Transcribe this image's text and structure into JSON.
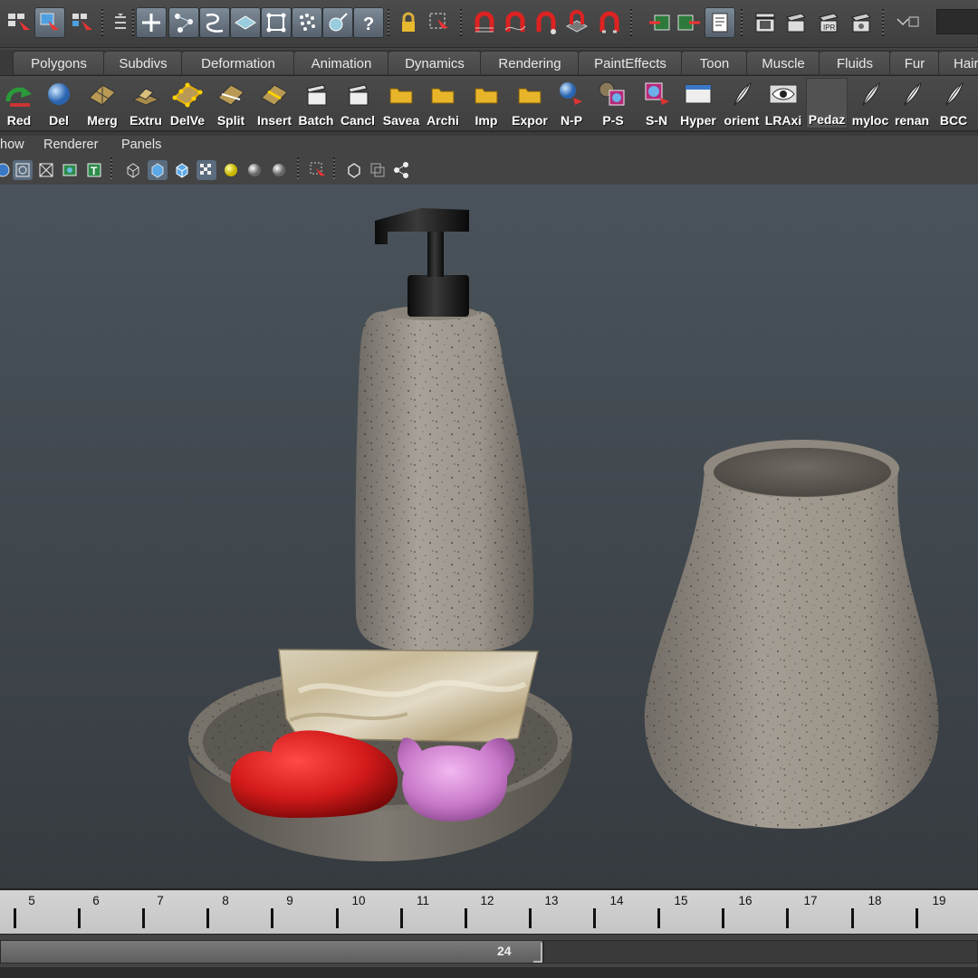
{
  "shelf_tabs": [
    "Polygons",
    "Subdivs",
    "Deformation",
    "Animation",
    "Dynamics",
    "Rendering",
    "PaintEffects",
    "Toon",
    "Muscle",
    "Fluids",
    "Fur",
    "Hair"
  ],
  "shelf_buttons": [
    "Red",
    "Del",
    "Merg",
    "Extru",
    "DelVe",
    "Split",
    "Insert",
    "Batch",
    "Cancl",
    "Savea",
    "Archi",
    "Imp",
    "Expor",
    "N-P",
    "P-S",
    "S-N",
    "Hyper",
    "orient",
    "LRAxi",
    "Pedaz",
    "myloc",
    "renan",
    "BCC"
  ],
  "panel_menu": {
    "show": "how",
    "renderer": "Renderer",
    "panels": "Panels"
  },
  "panel_toolbar": {
    "text_icon": "T"
  },
  "time_slider": {
    "frames": [
      "5",
      "6",
      "7",
      "8",
      "9",
      "10",
      "11",
      "12",
      "13",
      "14",
      "15",
      "16",
      "17",
      "18",
      "19"
    ]
  },
  "range_slider": {
    "value": "24"
  },
  "colors": {
    "viewport_top": "#4a535b",
    "viewport_bottom": "#363b40",
    "stone": "#a39c92",
    "soap_red": "#d21a1a",
    "soap_pink": "#c777c8"
  }
}
